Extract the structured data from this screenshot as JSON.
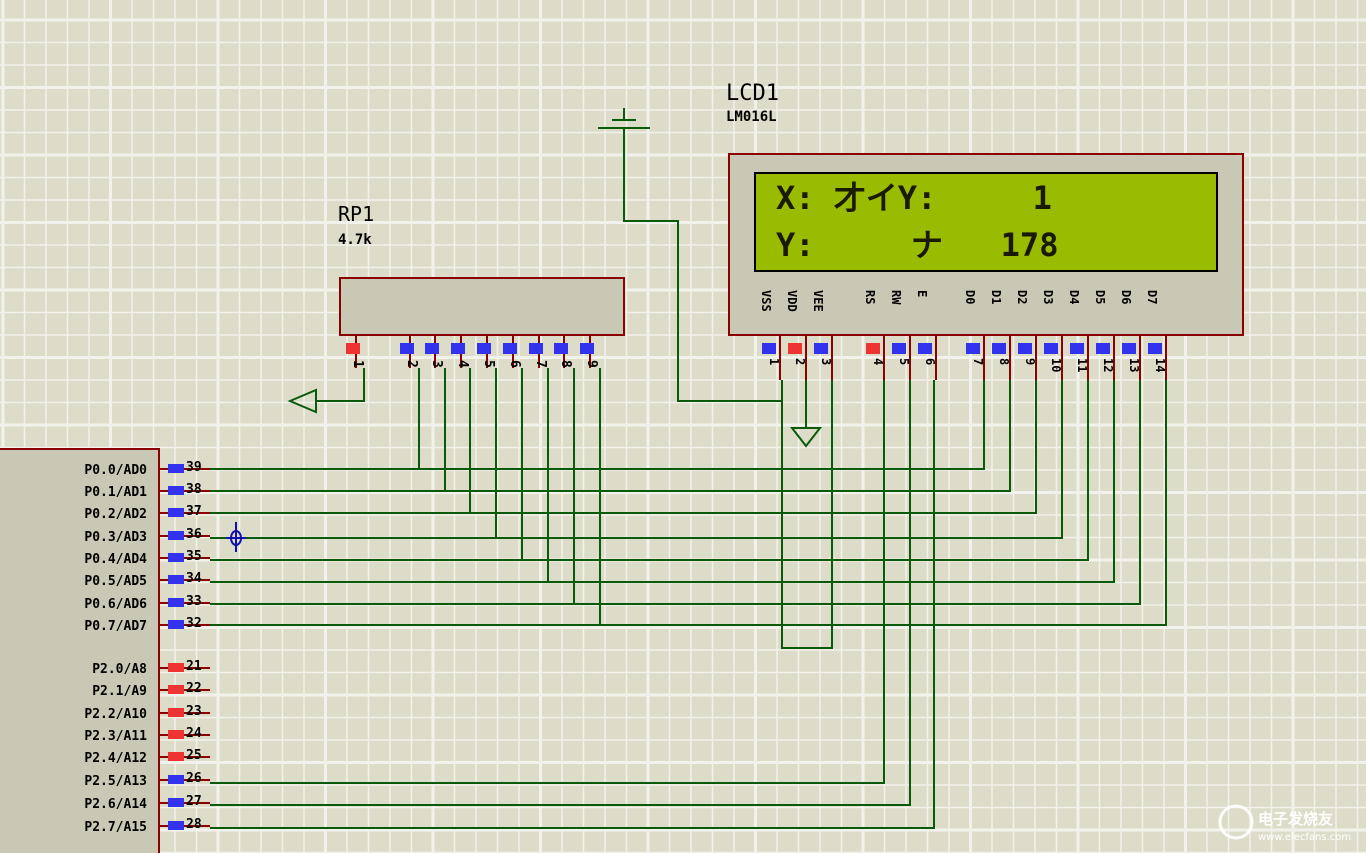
{
  "lcd": {
    "ref": "LCD1",
    "model": "LM016L",
    "line1": "X: 才イY:     1",
    "line2": "Y:     ナ   178",
    "pin_labels": [
      "VSS",
      "VDD",
      "VEE",
      "RS",
      "RW",
      "E",
      "D0",
      "D1",
      "D2",
      "D3",
      "D4",
      "D5",
      "D6",
      "D7"
    ],
    "pin_numbers": [
      "1",
      "2",
      "3",
      "4",
      "5",
      "6",
      "7",
      "8",
      "9",
      "10",
      "11",
      "12",
      "13",
      "14"
    ]
  },
  "rp": {
    "ref": "RP1",
    "value": "4.7k",
    "pin_numbers": [
      "1",
      "2",
      "3",
      "4",
      "5",
      "6",
      "7",
      "8",
      "9"
    ]
  },
  "mcu": {
    "port0": [
      {
        "label": "P0.0/AD0",
        "pin": "39"
      },
      {
        "label": "P0.1/AD1",
        "pin": "38"
      },
      {
        "label": "P0.2/AD2",
        "pin": "37"
      },
      {
        "label": "P0.3/AD3",
        "pin": "36"
      },
      {
        "label": "P0.4/AD4",
        "pin": "35"
      },
      {
        "label": "P0.5/AD5",
        "pin": "34"
      },
      {
        "label": "P0.6/AD6",
        "pin": "33"
      },
      {
        "label": "P0.7/AD7",
        "pin": "32"
      }
    ],
    "port2": [
      {
        "label": "P2.0/A8",
        "pin": "21"
      },
      {
        "label": "P2.1/A9",
        "pin": "22"
      },
      {
        "label": "P2.2/A10",
        "pin": "23"
      },
      {
        "label": "P2.3/A11",
        "pin": "24"
      },
      {
        "label": "P2.4/A12",
        "pin": "25"
      },
      {
        "label": "P2.5/A13",
        "pin": "26"
      },
      {
        "label": "P2.6/A14",
        "pin": "27"
      },
      {
        "label": "P2.7/A15",
        "pin": "28"
      }
    ]
  },
  "watermark": {
    "text": "电子发烧友",
    "url": "www.elecfans.com"
  },
  "colors": {
    "background": "#dcdcc8",
    "grid": "#f0f0f0",
    "wire": "#0b5a0b",
    "component_border": "#8b0000",
    "component_fill": "#c8c8b4",
    "lcd_screen": "#99bb00",
    "pin_blue": "#3333ee",
    "pin_red": "#ee3333"
  }
}
